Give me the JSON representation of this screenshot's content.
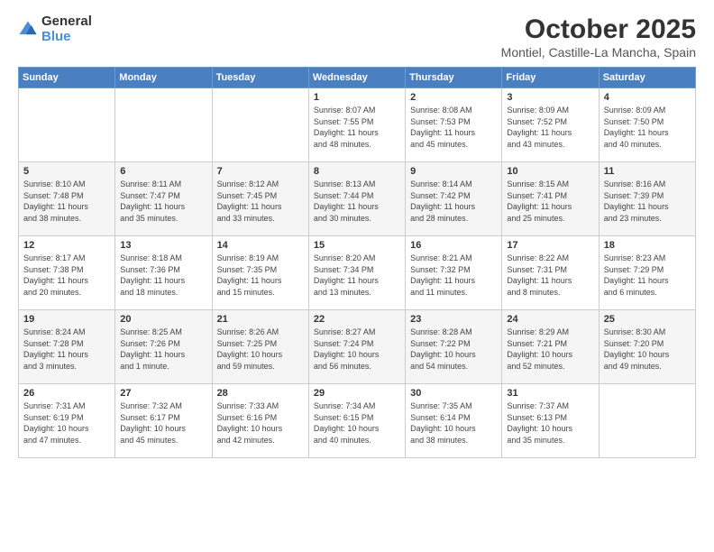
{
  "logo": {
    "general": "General",
    "blue": "Blue"
  },
  "header": {
    "month": "October 2025",
    "location": "Montiel, Castille-La Mancha, Spain"
  },
  "weekdays": [
    "Sunday",
    "Monday",
    "Tuesday",
    "Wednesday",
    "Thursday",
    "Friday",
    "Saturday"
  ],
  "weeks": [
    [
      {
        "day": "",
        "info": ""
      },
      {
        "day": "",
        "info": ""
      },
      {
        "day": "",
        "info": ""
      },
      {
        "day": "1",
        "info": "Sunrise: 8:07 AM\nSunset: 7:55 PM\nDaylight: 11 hours\nand 48 minutes."
      },
      {
        "day": "2",
        "info": "Sunrise: 8:08 AM\nSunset: 7:53 PM\nDaylight: 11 hours\nand 45 minutes."
      },
      {
        "day": "3",
        "info": "Sunrise: 8:09 AM\nSunset: 7:52 PM\nDaylight: 11 hours\nand 43 minutes."
      },
      {
        "day": "4",
        "info": "Sunrise: 8:09 AM\nSunset: 7:50 PM\nDaylight: 11 hours\nand 40 minutes."
      }
    ],
    [
      {
        "day": "5",
        "info": "Sunrise: 8:10 AM\nSunset: 7:48 PM\nDaylight: 11 hours\nand 38 minutes."
      },
      {
        "day": "6",
        "info": "Sunrise: 8:11 AM\nSunset: 7:47 PM\nDaylight: 11 hours\nand 35 minutes."
      },
      {
        "day": "7",
        "info": "Sunrise: 8:12 AM\nSunset: 7:45 PM\nDaylight: 11 hours\nand 33 minutes."
      },
      {
        "day": "8",
        "info": "Sunrise: 8:13 AM\nSunset: 7:44 PM\nDaylight: 11 hours\nand 30 minutes."
      },
      {
        "day": "9",
        "info": "Sunrise: 8:14 AM\nSunset: 7:42 PM\nDaylight: 11 hours\nand 28 minutes."
      },
      {
        "day": "10",
        "info": "Sunrise: 8:15 AM\nSunset: 7:41 PM\nDaylight: 11 hours\nand 25 minutes."
      },
      {
        "day": "11",
        "info": "Sunrise: 8:16 AM\nSunset: 7:39 PM\nDaylight: 11 hours\nand 23 minutes."
      }
    ],
    [
      {
        "day": "12",
        "info": "Sunrise: 8:17 AM\nSunset: 7:38 PM\nDaylight: 11 hours\nand 20 minutes."
      },
      {
        "day": "13",
        "info": "Sunrise: 8:18 AM\nSunset: 7:36 PM\nDaylight: 11 hours\nand 18 minutes."
      },
      {
        "day": "14",
        "info": "Sunrise: 8:19 AM\nSunset: 7:35 PM\nDaylight: 11 hours\nand 15 minutes."
      },
      {
        "day": "15",
        "info": "Sunrise: 8:20 AM\nSunset: 7:34 PM\nDaylight: 11 hours\nand 13 minutes."
      },
      {
        "day": "16",
        "info": "Sunrise: 8:21 AM\nSunset: 7:32 PM\nDaylight: 11 hours\nand 11 minutes."
      },
      {
        "day": "17",
        "info": "Sunrise: 8:22 AM\nSunset: 7:31 PM\nDaylight: 11 hours\nand 8 minutes."
      },
      {
        "day": "18",
        "info": "Sunrise: 8:23 AM\nSunset: 7:29 PM\nDaylight: 11 hours\nand 6 minutes."
      }
    ],
    [
      {
        "day": "19",
        "info": "Sunrise: 8:24 AM\nSunset: 7:28 PM\nDaylight: 11 hours\nand 3 minutes."
      },
      {
        "day": "20",
        "info": "Sunrise: 8:25 AM\nSunset: 7:26 PM\nDaylight: 11 hours\nand 1 minute."
      },
      {
        "day": "21",
        "info": "Sunrise: 8:26 AM\nSunset: 7:25 PM\nDaylight: 10 hours\nand 59 minutes."
      },
      {
        "day": "22",
        "info": "Sunrise: 8:27 AM\nSunset: 7:24 PM\nDaylight: 10 hours\nand 56 minutes."
      },
      {
        "day": "23",
        "info": "Sunrise: 8:28 AM\nSunset: 7:22 PM\nDaylight: 10 hours\nand 54 minutes."
      },
      {
        "day": "24",
        "info": "Sunrise: 8:29 AM\nSunset: 7:21 PM\nDaylight: 10 hours\nand 52 minutes."
      },
      {
        "day": "25",
        "info": "Sunrise: 8:30 AM\nSunset: 7:20 PM\nDaylight: 10 hours\nand 49 minutes."
      }
    ],
    [
      {
        "day": "26",
        "info": "Sunrise: 7:31 AM\nSunset: 6:19 PM\nDaylight: 10 hours\nand 47 minutes."
      },
      {
        "day": "27",
        "info": "Sunrise: 7:32 AM\nSunset: 6:17 PM\nDaylight: 10 hours\nand 45 minutes."
      },
      {
        "day": "28",
        "info": "Sunrise: 7:33 AM\nSunset: 6:16 PM\nDaylight: 10 hours\nand 42 minutes."
      },
      {
        "day": "29",
        "info": "Sunrise: 7:34 AM\nSunset: 6:15 PM\nDaylight: 10 hours\nand 40 minutes."
      },
      {
        "day": "30",
        "info": "Sunrise: 7:35 AM\nSunset: 6:14 PM\nDaylight: 10 hours\nand 38 minutes."
      },
      {
        "day": "31",
        "info": "Sunrise: 7:37 AM\nSunset: 6:13 PM\nDaylight: 10 hours\nand 35 minutes."
      },
      {
        "day": "",
        "info": ""
      }
    ]
  ]
}
